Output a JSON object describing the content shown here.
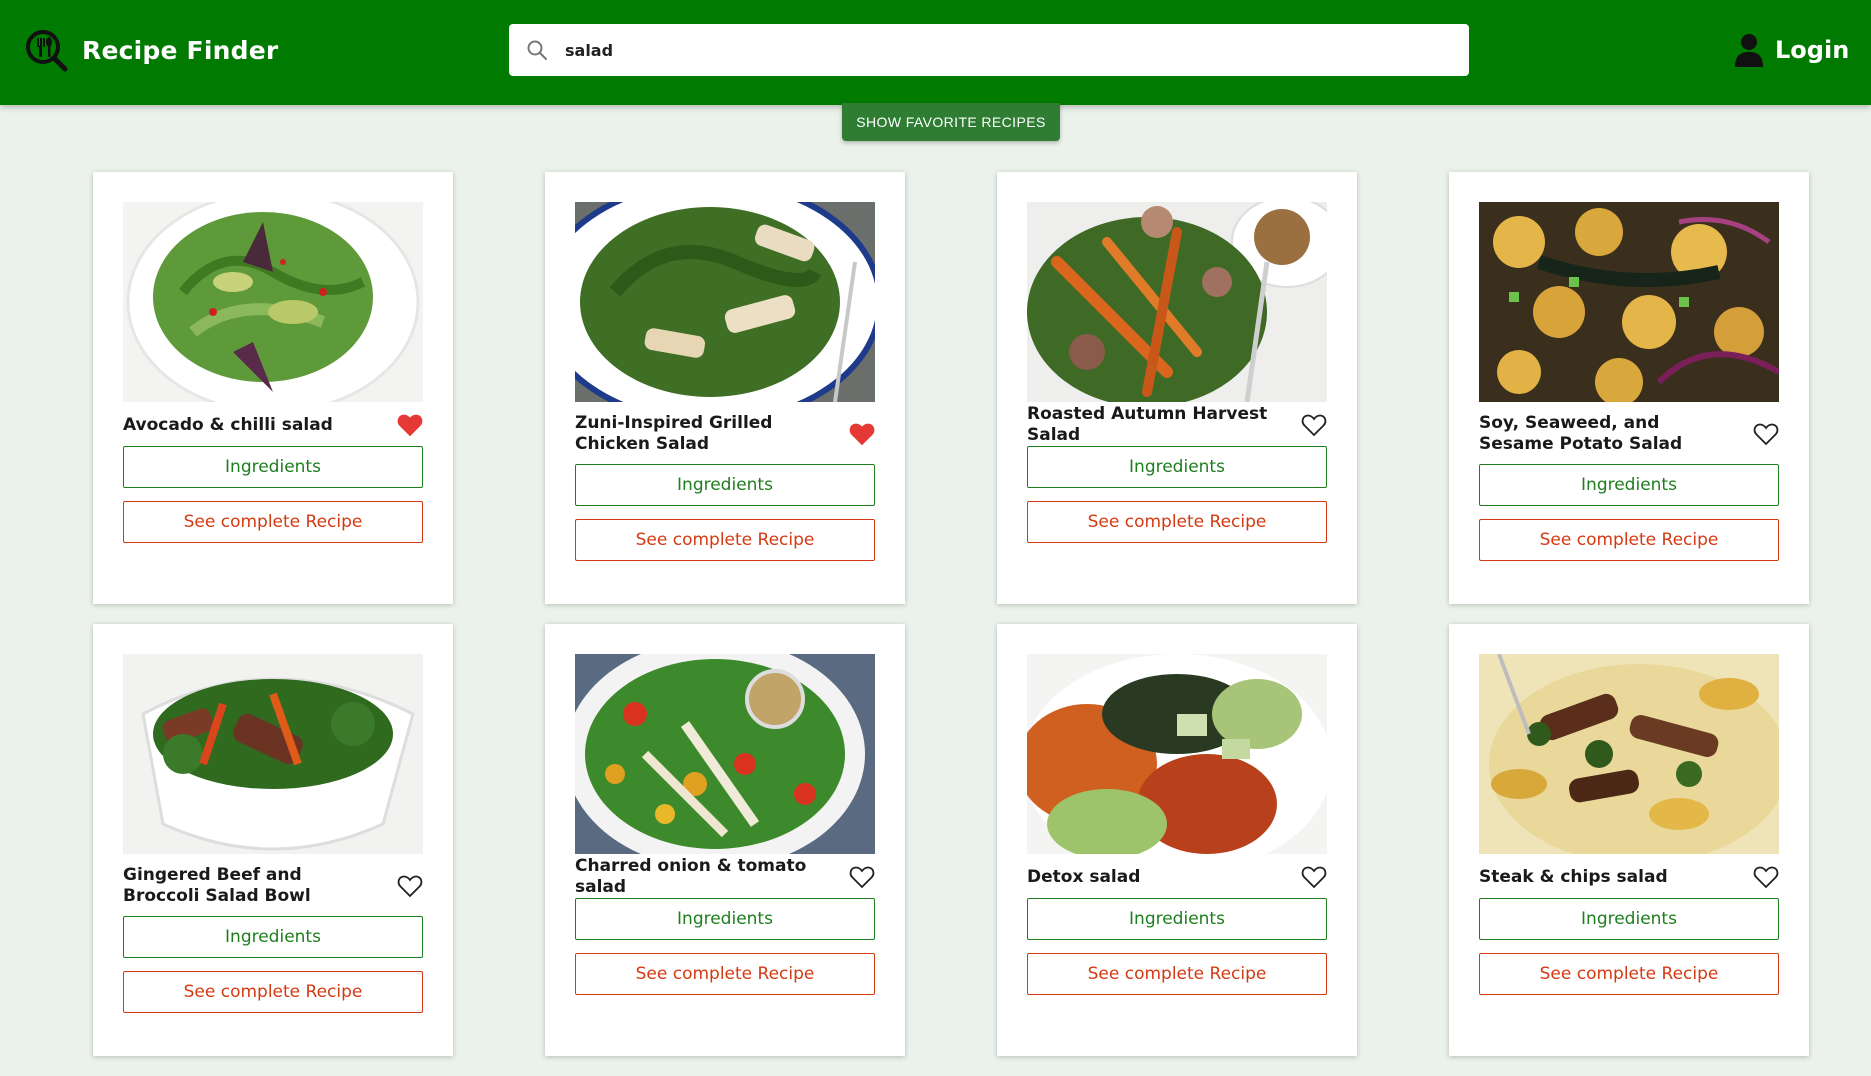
{
  "app": {
    "title": "Recipe Finder",
    "login_label": "Login"
  },
  "search": {
    "value": "salad",
    "placeholder": ""
  },
  "favorites_button": "SHOW FAVORITE RECIPES",
  "buttons": {
    "ingredients": "Ingredients",
    "see_recipe": "See complete Recipe"
  },
  "colors": {
    "header": "#007a00",
    "favorite_heart": "#e53935",
    "ingredients": "#1e7e1e",
    "recipe": "#d43a12"
  },
  "recipes": [
    {
      "title": "Avocado & chilli salad",
      "favorite": true
    },
    {
      "title": "Zuni-Inspired Grilled Chicken Salad",
      "favorite": true
    },
    {
      "title": "Roasted Autumn Harvest Salad",
      "favorite": false
    },
    {
      "title": "Soy, Seaweed, and Sesame Potato Salad",
      "favorite": false
    },
    {
      "title": "Gingered Beef and Broccoli Salad Bowl",
      "favorite": false
    },
    {
      "title": "Charred onion & tomato salad",
      "favorite": false
    },
    {
      "title": "Detox salad",
      "favorite": false
    },
    {
      "title": "Steak & chips salad",
      "favorite": false
    }
  ]
}
